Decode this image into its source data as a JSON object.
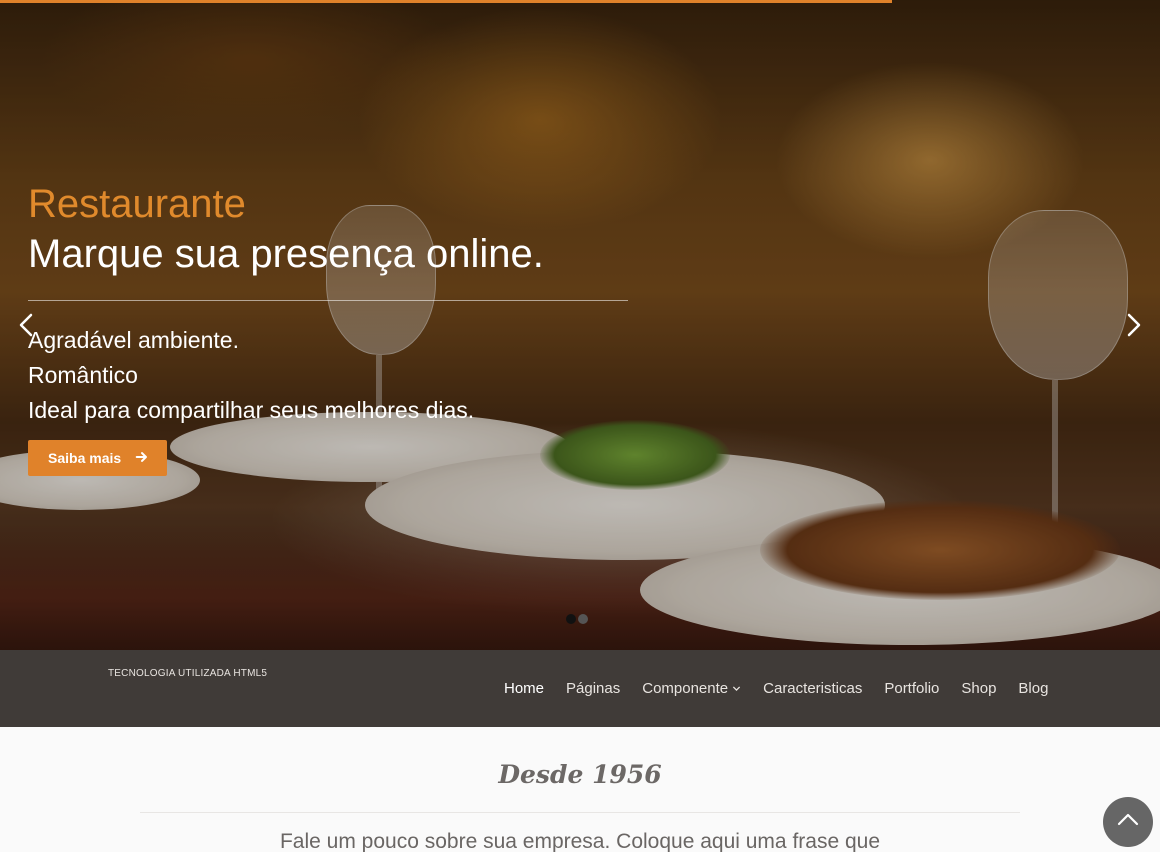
{
  "hero": {
    "kicker": "Restaurante",
    "title": "Marque sua presença online.",
    "lines": [
      "Agradável ambiente.",
      "Romântico",
      "Ideal para compartilhar seus melhores dias."
    ],
    "cta_label": "Saiba mais",
    "slides": {
      "count": 2,
      "active_index": 0
    }
  },
  "navbar": {
    "brand": "TECNOLOGIA UTILIZADA HTML5",
    "items": [
      {
        "label": "Home",
        "active": true
      },
      {
        "label": "Páginas"
      },
      {
        "label": "Componente",
        "has_dropdown": true
      },
      {
        "label": "Caracteristicas"
      },
      {
        "label": "Portfolio"
      },
      {
        "label": "Shop"
      },
      {
        "label": "Blog"
      }
    ]
  },
  "content": {
    "since": "Desde 1956",
    "about": "Fale um pouco sobre sua empresa. Coloque aqui uma frase que"
  },
  "colors": {
    "accent": "#e0822a",
    "navbar": "#403b38",
    "background": "#fafafa"
  },
  "icons": {
    "prev": "chevron-left-icon",
    "next": "chevron-right-icon",
    "cta": "arrow-right-icon",
    "dropdown": "chevron-down-icon",
    "to_top": "chevron-up-icon"
  }
}
